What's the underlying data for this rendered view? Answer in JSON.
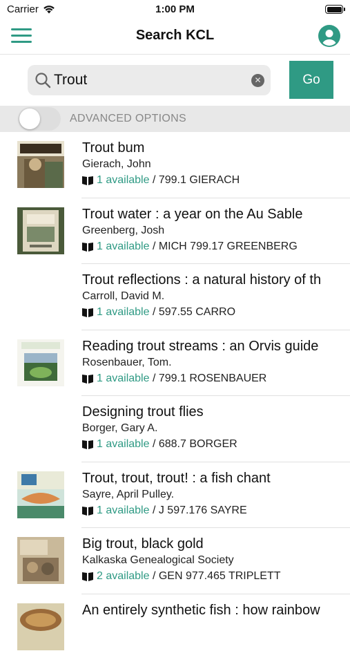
{
  "status_bar": {
    "carrier": "Carrier",
    "time": "1:00 PM"
  },
  "header": {
    "title": "Search KCL"
  },
  "search": {
    "query": "Trout",
    "go_label": "Go"
  },
  "advanced": {
    "label": "ADVANCED OPTIONS",
    "enabled": false
  },
  "colors": {
    "accent": "#2f9a84"
  },
  "results": [
    {
      "title": "Trout bum",
      "author": "Gierach, John",
      "availability": "1 available",
      "call_number": "799.1 GIERACH",
      "has_cover": true
    },
    {
      "title": "Trout water : a year on the Au Sable",
      "author": "Greenberg, Josh",
      "availability": "1 available",
      "call_number": "MICH 799.17 GREENBERG",
      "has_cover": true
    },
    {
      "title": "Trout reflections : a natural history of th",
      "author": "Carroll, David M.",
      "availability": "1 available",
      "call_number": "597.55 CARRO",
      "has_cover": false
    },
    {
      "title": "Reading trout streams : an Orvis guide",
      "author": "Rosenbauer, Tom.",
      "availability": "1 available",
      "call_number": "799.1 ROSENBAUER",
      "has_cover": true
    },
    {
      "title": "Designing trout flies",
      "author": "Borger, Gary A.",
      "availability": "1 available",
      "call_number": "688.7 BORGER",
      "has_cover": false
    },
    {
      "title": "Trout, trout, trout! : a fish chant",
      "author": "Sayre, April Pulley.",
      "availability": "1 available",
      "call_number": "J 597.176 SAYRE",
      "has_cover": true
    },
    {
      "title": "Big trout, black gold",
      "author": "Kalkaska Genealogical Society",
      "availability": "2 available",
      "call_number": "GEN 977.465 TRIPLETT",
      "has_cover": true
    },
    {
      "title": "An entirely synthetic fish : how rainbow",
      "author": "",
      "availability": "",
      "call_number": "",
      "has_cover": true
    }
  ]
}
